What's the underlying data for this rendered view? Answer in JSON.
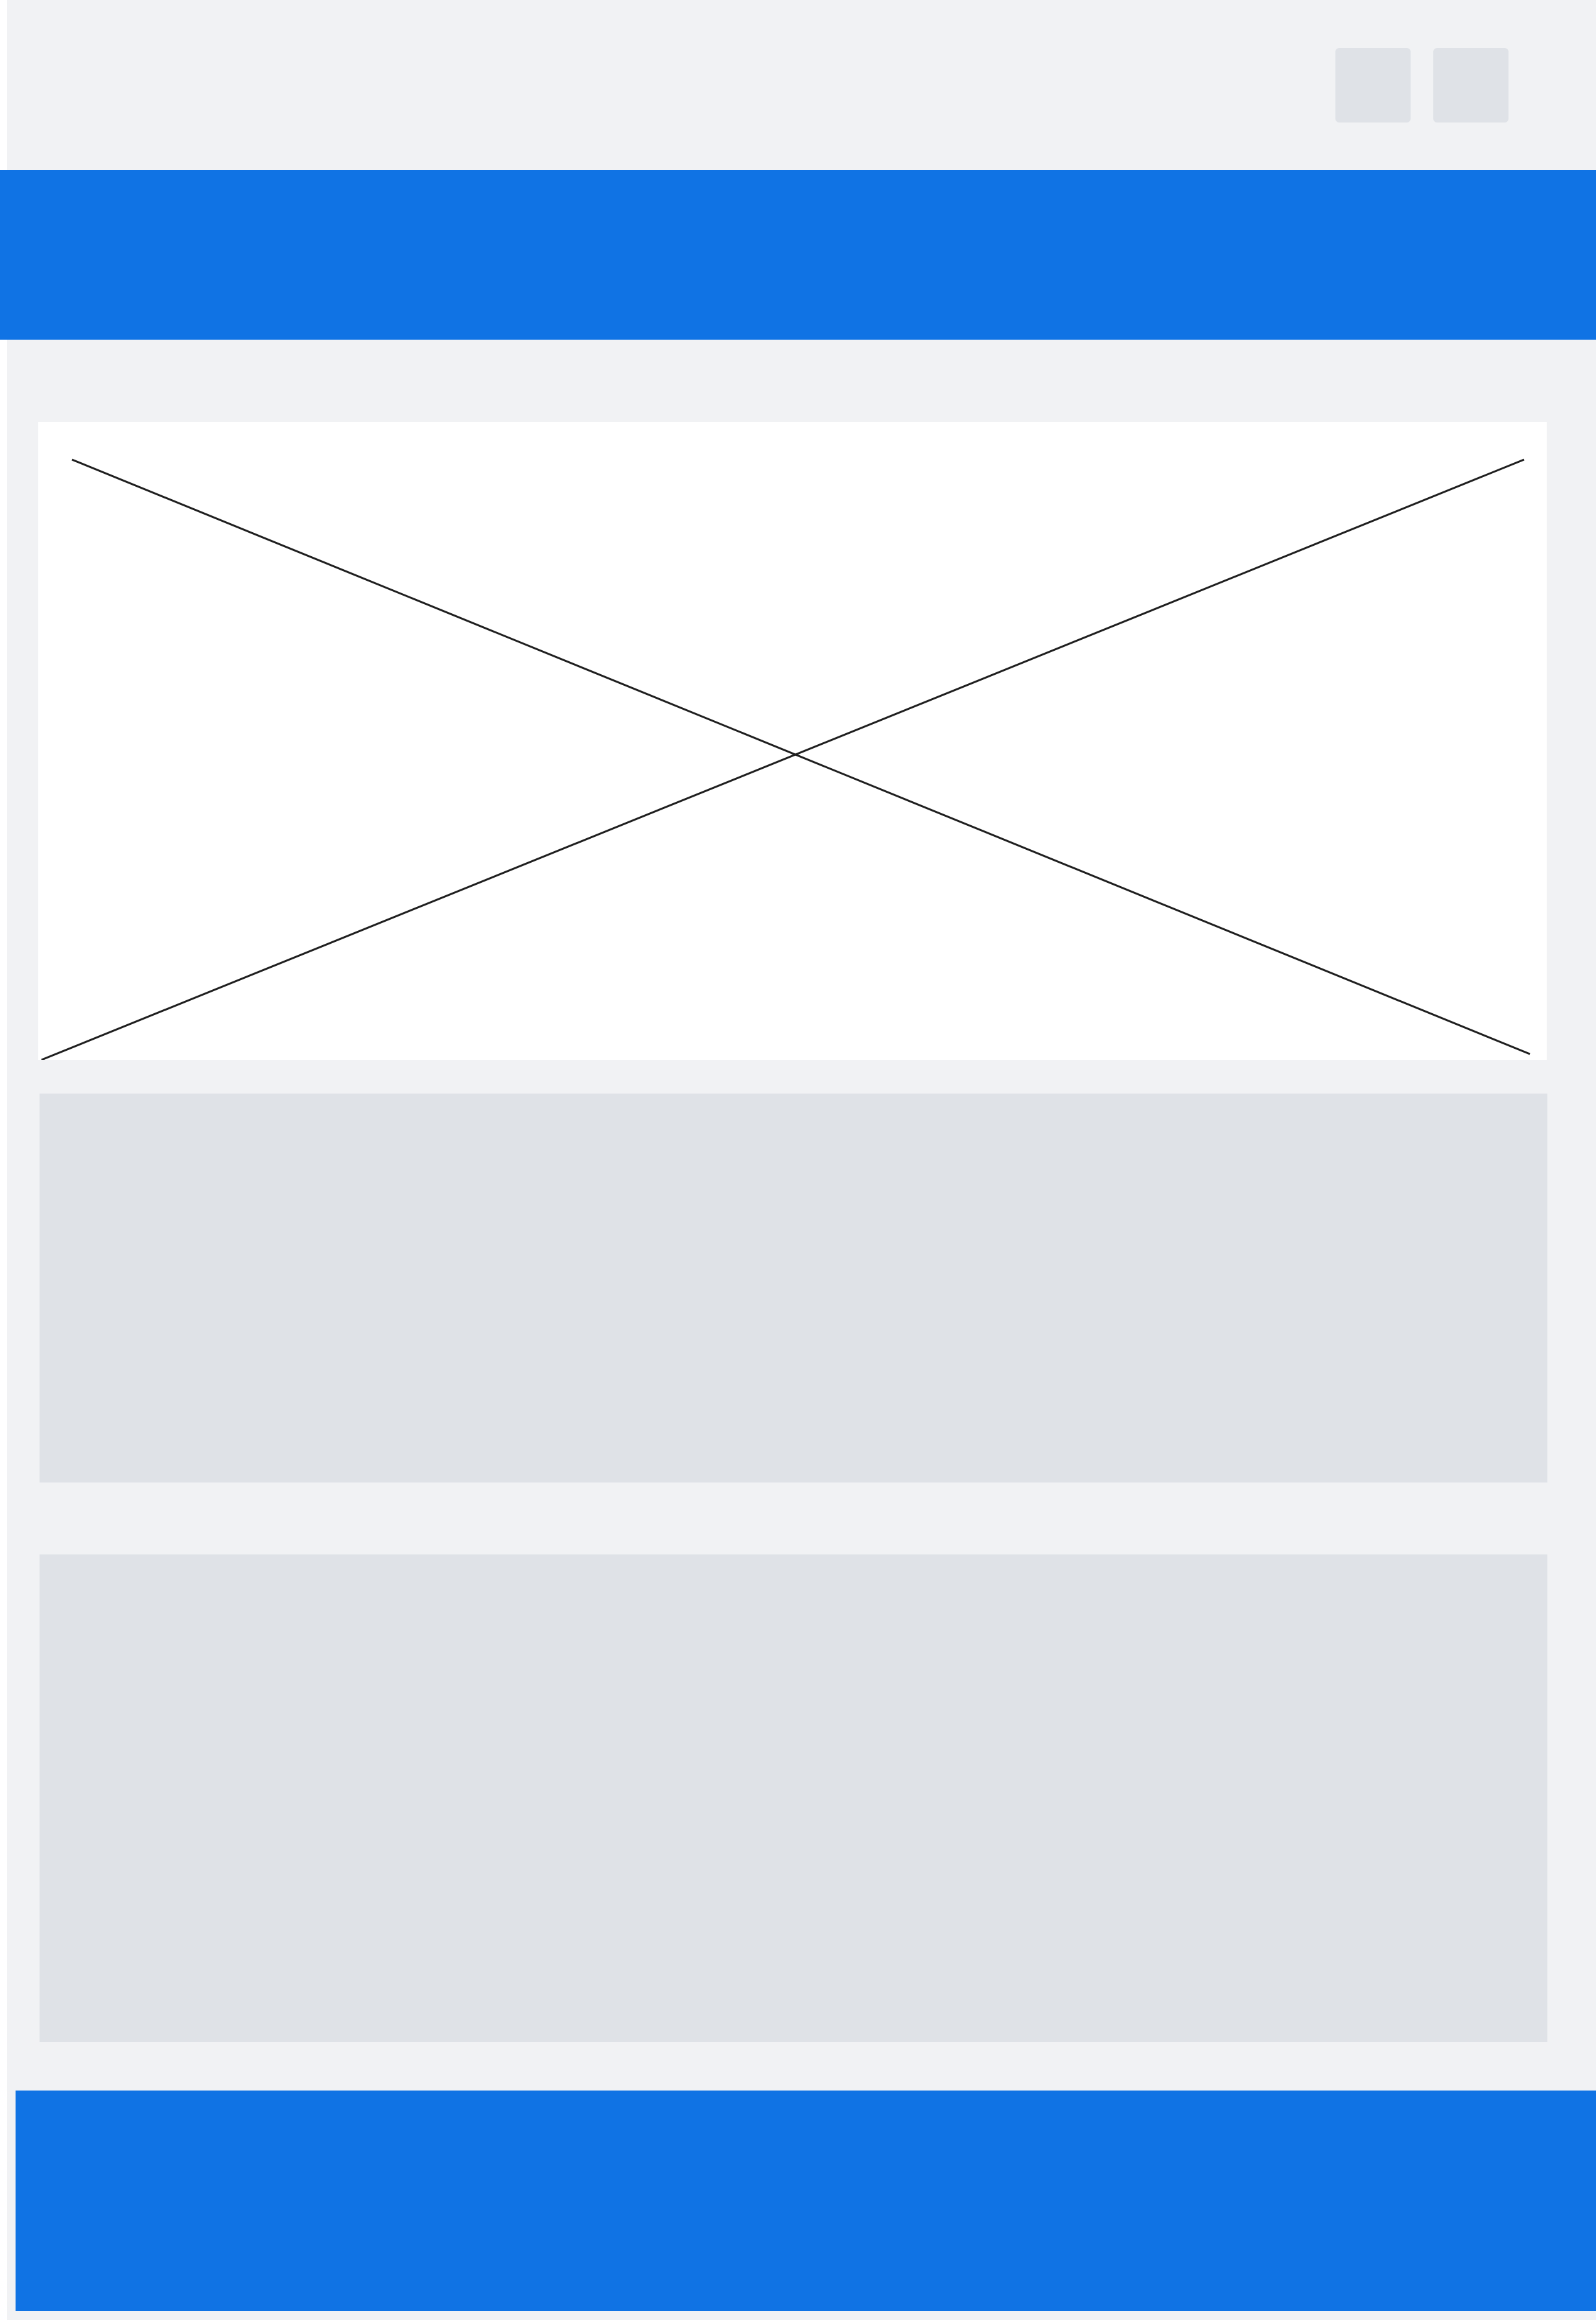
{
  "colors": {
    "page_background": "#f1f2f4",
    "accent": "#1073e4",
    "placeholder": "#dfe2e7",
    "image_background": "#ffffff",
    "image_stroke": "#1f1f1f"
  },
  "header": {
    "buttons": [
      {
        "icon": "placeholder-button"
      },
      {
        "icon": "placeholder-button"
      }
    ]
  },
  "hero": {
    "icon": "image-placeholder-icon"
  }
}
